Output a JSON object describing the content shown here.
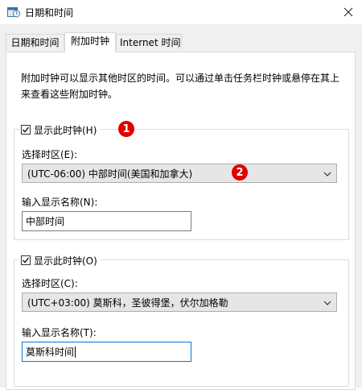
{
  "window": {
    "title": "日期和时间",
    "icon": "clock-calendar-icon",
    "close_icon": "close-icon"
  },
  "tabs": [
    {
      "label": "日期和时间",
      "active": false
    },
    {
      "label": "附加时钟",
      "active": true
    },
    {
      "label": "Internet 时间",
      "active": false
    }
  ],
  "description": "附加时钟可以显示其他时区的时间。可以通过单击任务栏时钟或悬停在其上来查看这些附加时钟。",
  "clock1": {
    "show_label": "显示此时钟(H)",
    "checked": true,
    "timezone_label": "选择时区(E):",
    "timezone_value": "(UTC-06:00) 中部时间(美国和加拿大)",
    "name_label": "输入显示名称(N):",
    "name_value": "中部时间"
  },
  "clock2": {
    "show_label": "显示此时钟(O)",
    "checked": true,
    "timezone_label": "选择时区(C):",
    "timezone_value": "(UTC+03:00) 莫斯科，圣彼得堡，伏尔加格勒",
    "name_label": "输入显示名称(T):",
    "name_value": "莫斯科时间"
  },
  "annotations": [
    "1",
    "2"
  ],
  "colors": {
    "accent": "#0078d7",
    "badge": "#e00000"
  }
}
